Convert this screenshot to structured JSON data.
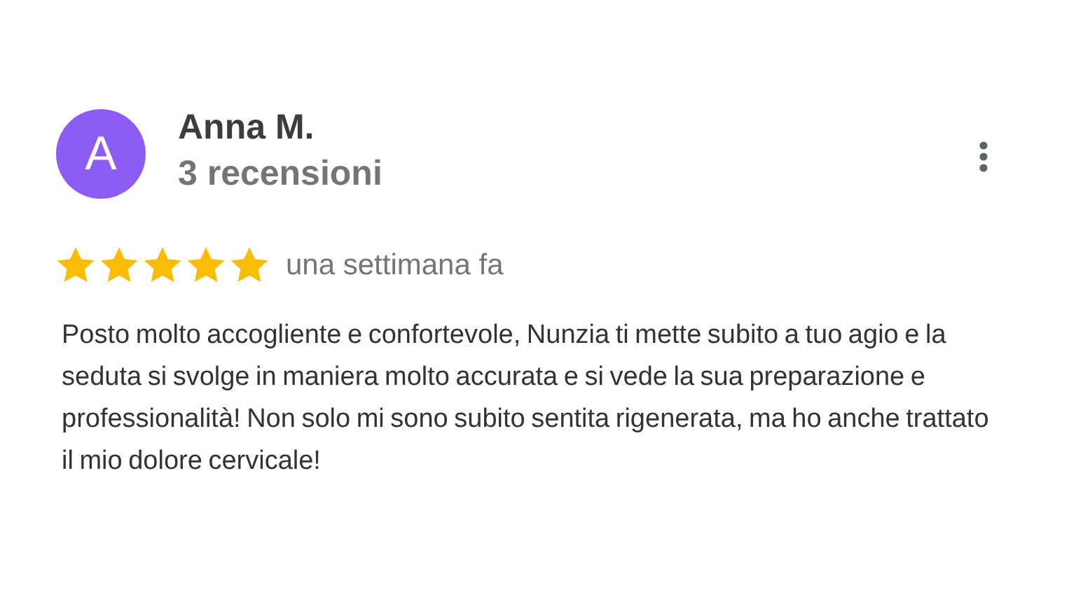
{
  "review": {
    "avatar_letter": "A",
    "author": "Anna M.",
    "review_count": "3 recensioni",
    "stars": 5,
    "time": "una settimana fa",
    "text": "Posto molto accogliente e confortevole, Nunzia ti mette subito a tuo agio e la seduta si svolge in maniera molto accurata e si vede la sua preparazione e professionalità! Non solo mi sono subito sentita rigenerata, ma ho anche trattato il mio dolore cervicale!"
  }
}
